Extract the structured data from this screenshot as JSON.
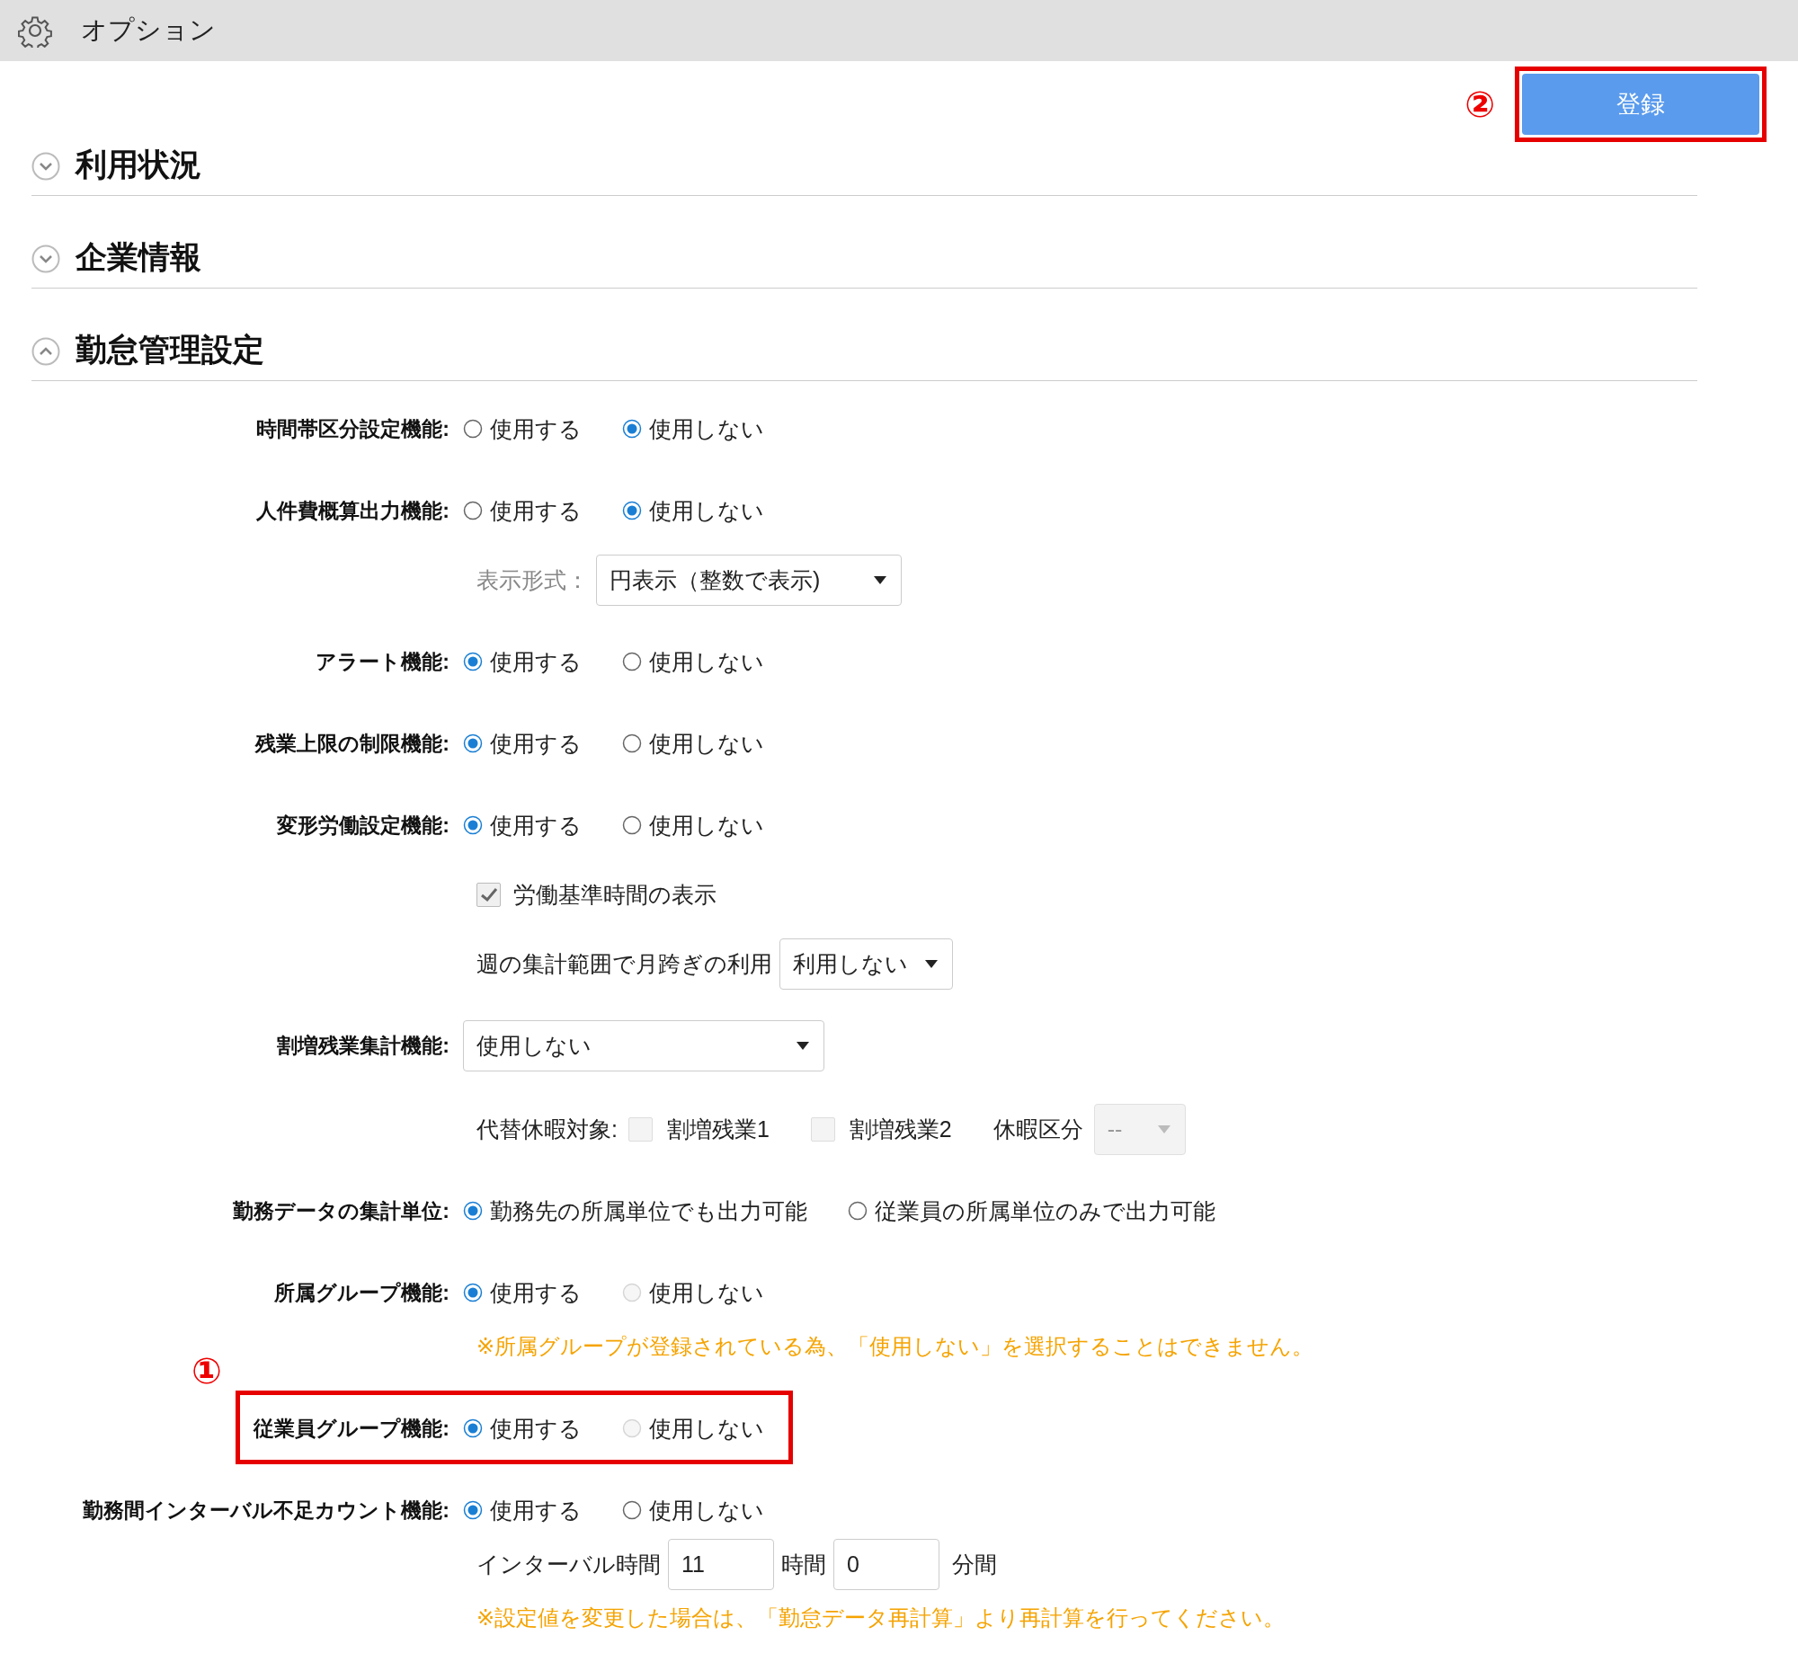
{
  "window": {
    "title": "オプション"
  },
  "register_button": {
    "label": "登録",
    "callout": "②"
  },
  "sections": [
    {
      "title": "利用状況",
      "expanded": false
    },
    {
      "title": "企業情報",
      "expanded": false
    },
    {
      "title": "勤怠管理設定",
      "expanded": true,
      "rows": [
        {
          "kind": "radio",
          "label": "時間帯区分設定機能:",
          "options": [
            {
              "label": "使用する",
              "selected": false,
              "disabled": false
            },
            {
              "label": "使用しない",
              "selected": true,
              "disabled": false
            }
          ]
        },
        {
          "kind": "radio",
          "label": "人件費概算出力機能:",
          "options": [
            {
              "label": "使用する",
              "selected": false,
              "disabled": false
            },
            {
              "label": "使用しない",
              "selected": true,
              "disabled": false
            }
          ]
        },
        {
          "kind": "subselect",
          "label": "表示形式：",
          "value": "円表示（整数で表示)"
        },
        {
          "kind": "radio",
          "label": "アラート機能:",
          "options": [
            {
              "label": "使用する",
              "selected": true,
              "disabled": false
            },
            {
              "label": "使用しない",
              "selected": false,
              "disabled": false
            }
          ]
        },
        {
          "kind": "radio",
          "label": "残業上限の制限機能:",
          "options": [
            {
              "label": "使用する",
              "selected": true,
              "disabled": false
            },
            {
              "label": "使用しない",
              "selected": false,
              "disabled": false
            }
          ]
        },
        {
          "kind": "radio",
          "label": "変形労働設定機能:",
          "options": [
            {
              "label": "使用する",
              "selected": true,
              "disabled": false
            },
            {
              "label": "使用しない",
              "selected": false,
              "disabled": false
            }
          ]
        },
        {
          "kind": "checkbox",
          "label": "労働基準時間の表示",
          "checked": true
        },
        {
          "kind": "inlineselect",
          "label": "週の集計範囲で月跨ぎの利用",
          "value": "利用しない"
        },
        {
          "kind": "select",
          "label": "割増残業集計機能:",
          "value": "使用しない"
        },
        {
          "kind": "substitute",
          "label": "代替休暇対象:",
          "checkboxes": [
            {
              "label": "割増残業1",
              "checked": false
            },
            {
              "label": "割増残業2",
              "checked": false
            }
          ],
          "leave_label": "休暇区分",
          "leave_value": "--",
          "leave_disabled": true
        },
        {
          "kind": "radio",
          "label": "勤務データの集計単位:",
          "options": [
            {
              "label": "勤務先の所属単位でも出力可能",
              "selected": true,
              "disabled": false
            },
            {
              "label": "従業員の所属単位のみで出力可能",
              "selected": false,
              "disabled": false
            }
          ]
        },
        {
          "kind": "radio",
          "label": "所属グループ機能:",
          "options": [
            {
              "label": "使用する",
              "selected": true,
              "disabled": false
            },
            {
              "label": "使用しない",
              "selected": false,
              "disabled": true
            }
          ]
        },
        {
          "kind": "note",
          "text": "※所属グループが登録されている為、「使用しない」を選択することはできません。"
        },
        {
          "kind": "radio",
          "label": "従業員グループ機能:",
          "callout": "①",
          "options": [
            {
              "label": "使用する",
              "selected": true,
              "disabled": false
            },
            {
              "label": "使用しない",
              "selected": false,
              "disabled": true
            }
          ]
        },
        {
          "kind": "radio",
          "label": "勤務間インターバル不足カウント機能:",
          "options": [
            {
              "label": "使用する",
              "selected": true,
              "disabled": false
            },
            {
              "label": "使用しない",
              "selected": false,
              "disabled": false
            }
          ]
        },
        {
          "kind": "interval",
          "label": "インターバル時間",
          "hours": "11",
          "hours_unit": "時間",
          "minutes": "0",
          "minutes_unit": "分間"
        },
        {
          "kind": "note",
          "text": "※設定値を変更した場合は、「勤怠データ再計算」より再計算を行ってください。"
        }
      ]
    }
  ]
}
